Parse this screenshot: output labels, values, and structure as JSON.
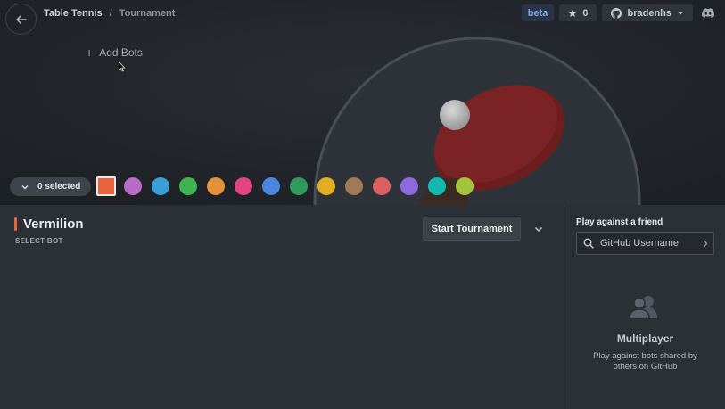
{
  "breadcrumb": {
    "root": "Table Tennis",
    "separator": "/",
    "current": "Tournament"
  },
  "header": {
    "beta_label": "beta",
    "star_count": "0",
    "username": "bradenhs"
  },
  "add_bots_label": "Add Bots",
  "selector": {
    "label": "0 selected"
  },
  "bot_colors": [
    "#e8643f",
    "#b86cc4",
    "#3a9fd6",
    "#3db44f",
    "#e2913a",
    "#e2457e",
    "#4a86e0",
    "#2e9b5b",
    "#e3ac22",
    "#a07a57",
    "#db6062",
    "#8b6ae0",
    "#12b9b0",
    "#a2c43a"
  ],
  "main": {
    "bot_name": "Vermilion",
    "bot_accent": "#e8643f",
    "select_bot_label": "SELECT BOT",
    "start_button": "Start Tournament"
  },
  "friend_panel": {
    "title": "Play against a friend",
    "input_placeholder": "GitHub Username",
    "multiplayer_title": "Multiplayer",
    "multiplayer_desc": "Play against bots shared by others on GitHub"
  }
}
